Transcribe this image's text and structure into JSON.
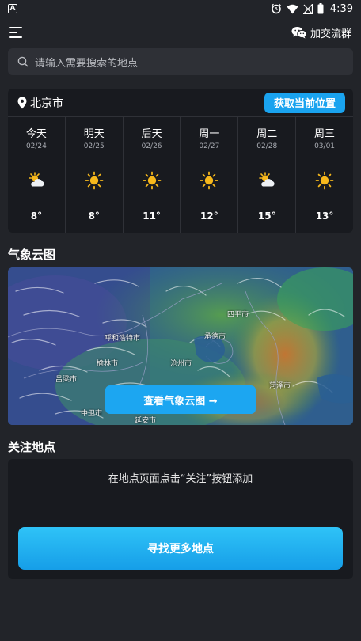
{
  "status_bar": {
    "notification": "A",
    "time": "4:39"
  },
  "header": {
    "menu_icon": "hamburger-menu-icon",
    "join_group_label": "加交流群",
    "join_group_icon": "wechat-icon"
  },
  "search": {
    "placeholder": "请输入需要搜索的地点",
    "icon": "search-icon"
  },
  "forecast": {
    "city": "北京市",
    "locate_label": "获取当前位置",
    "days": [
      {
        "name": "今天",
        "date": "02/24",
        "icon": "partly-cloudy-icon",
        "temp": "8°"
      },
      {
        "name": "明天",
        "date": "02/25",
        "icon": "sunny-icon",
        "temp": "8°"
      },
      {
        "name": "后天",
        "date": "02/26",
        "icon": "sunny-icon",
        "temp": "11°"
      },
      {
        "name": "周一",
        "date": "02/27",
        "icon": "sunny-icon",
        "temp": "12°"
      },
      {
        "name": "周二",
        "date": "02/28",
        "icon": "partly-cloudy-icon",
        "temp": "15°"
      },
      {
        "name": "周三",
        "date": "03/01",
        "icon": "sunny-icon",
        "temp": "13°"
      }
    ]
  },
  "cloud_map": {
    "title": "气象云图",
    "button_label": "查看气象云图 →",
    "labels": [
      "呼和浩特市",
      "承德市",
      "四平市",
      "沧州市",
      "榆林市",
      "吕梁市",
      "中卫市",
      "延安市",
      "菏泽市"
    ]
  },
  "follow": {
    "title": "关注地点",
    "hint": "在地点页面点击“关注”按钮添加",
    "button_label": "寻找更多地点"
  },
  "colors": {
    "background": "#222429",
    "card": "#181a1f",
    "accent": "#1aa3ef",
    "sun": "#f6b81c"
  }
}
